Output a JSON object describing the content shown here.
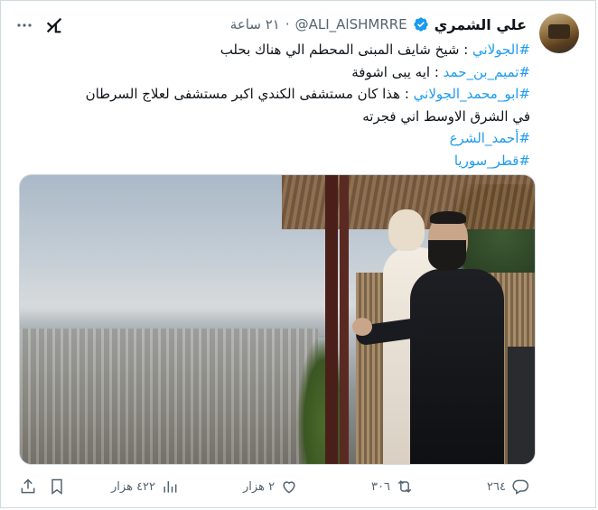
{
  "header": {
    "display_name": "علي الشمري",
    "handle": "@ALI_AlSHMRRE",
    "separator": "·",
    "time": "٢١ ساعة"
  },
  "tweet": {
    "lines": [
      {
        "hashtag": "#الجولاني",
        "text": " : شيخ شايف المبنى المحطم الي هناك بحلب"
      },
      {
        "hashtag": "#تميم_بن_حمد",
        "text": " : ايه يبى اشوفة"
      },
      {
        "hashtag": "#ابو_محمد_الجولاني",
        "text": " : هذا كان مستشفى الكندي اكبر مستشفى لعلاج السرطان"
      },
      {
        "hashtag": "",
        "text": "في الشرق الاوسط اني فجرته"
      },
      {
        "hashtag": "#أحمد_الشرع",
        "text": ""
      },
      {
        "hashtag": "#قطر_سوريا",
        "text": ""
      }
    ]
  },
  "actions": {
    "replies": "٢٦٤",
    "reposts": "٣٠٦",
    "likes": "٢ هزار",
    "views": "٤٢٢ هزار"
  },
  "colors": {
    "link": "#1d9bf0",
    "muted": "#536471",
    "verified": "#1d9bf0"
  },
  "icons": [
    "grok-icon",
    "more-icon",
    "verified-badge-icon",
    "reply-icon",
    "repost-icon",
    "like-icon",
    "views-icon",
    "bookmark-icon",
    "share-icon"
  ]
}
